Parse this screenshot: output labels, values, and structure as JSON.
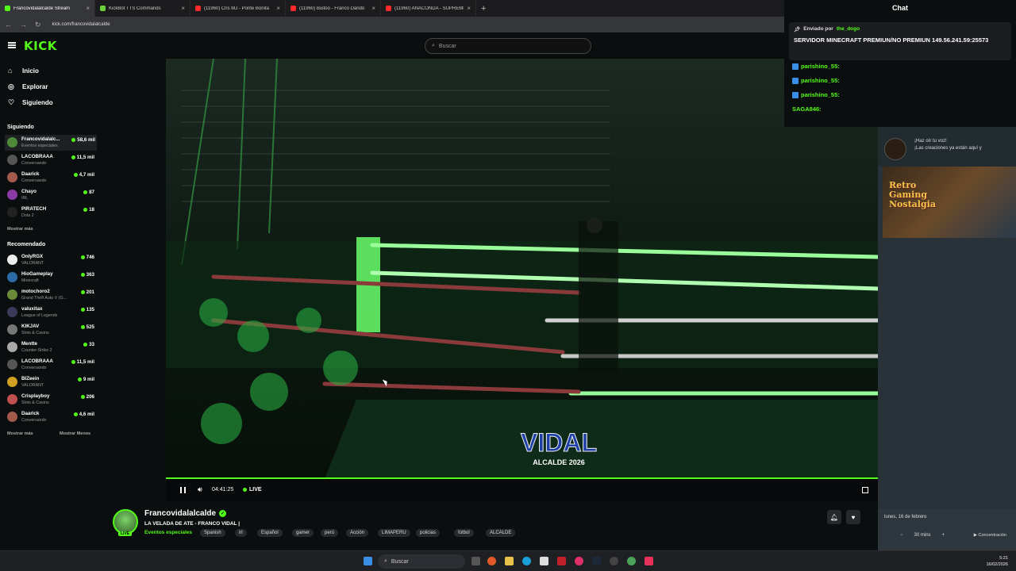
{
  "browser": {
    "tabs": [
      {
        "title": "Francovidalalcalde Stream",
        "active": true,
        "color": "#53fc18"
      },
      {
        "title": "KickBot TTS Commands",
        "active": false,
        "color": "#6bd13a"
      },
      {
        "title": "(11960) Cris MJ - Ponte Bonita",
        "active": false,
        "color": "#ff2a2a"
      },
      {
        "title": "(11960) Buitoo - Franco Dando",
        "active": false,
        "color": "#ff2a2a"
      },
      {
        "title": "(11960) ANACONDA - SUPREME",
        "active": false,
        "color": "#ff2a2a"
      }
    ],
    "url": "kick.com/francovidalalcalde"
  },
  "header": {
    "logo": "KICK",
    "search_placeholder": "Buscar"
  },
  "sidebar": {
    "nav": [
      {
        "label": "Inicio",
        "icon": "home-icon"
      },
      {
        "label": "Explorar",
        "icon": "compass-icon"
      },
      {
        "label": "Siguiendo",
        "icon": "heart-icon"
      }
    ],
    "following_title": "Siguiendo",
    "following": [
      {
        "name": "Francovidalalc...",
        "category": "Eventos especiales",
        "viewers": "58,6 mil",
        "color": "#4e8a3a"
      },
      {
        "name": "LACOBRAAA",
        "category": "Conversando",
        "viewers": "11,5 mil",
        "color": "#555"
      },
      {
        "name": "Daarick",
        "category": "Conversando",
        "viewers": "4,7 mil",
        "color": "#a35a4a"
      },
      {
        "name": "Chayo",
        "category": "IRL",
        "viewers": "87",
        "color": "#8a3aa5"
      },
      {
        "name": "PIRATECH",
        "category": "Dota 2",
        "viewers": "18",
        "color": "#222"
      }
    ],
    "show_more": "Mostrar más",
    "recommended_title": "Recomendado",
    "recommended": [
      {
        "name": "OnlyRGX",
        "category": "VALORANT",
        "viewers": "746",
        "color": "#eee"
      },
      {
        "name": "HioGameplay",
        "category": "Minecraft",
        "viewers": "363",
        "color": "#2a6aa5"
      },
      {
        "name": "motochoro2",
        "category": "Grand Theft Auto V (G...",
        "viewers": "201",
        "color": "#6a8a3a"
      },
      {
        "name": "valuxitax",
        "category": "League of Legends",
        "viewers": "135",
        "color": "#3a3a5a"
      },
      {
        "name": "KIKJAV",
        "category": "Slots & Casino",
        "viewers": "525",
        "color": "#777"
      },
      {
        "name": "Mentte",
        "category": "Counter-Strike 2",
        "viewers": "33",
        "color": "#aaa"
      },
      {
        "name": "LACOBRAAA",
        "category": "Conversando",
        "viewers": "11,5 mil",
        "color": "#555"
      },
      {
        "name": "BIZeein",
        "category": "VALORANT",
        "viewers": "9 mil",
        "color": "#d0a020"
      },
      {
        "name": "Crisplayboy",
        "category": "Slots & Casino",
        "viewers": "206",
        "color": "#c05050"
      },
      {
        "name": "Daarick",
        "category": "Conversando",
        "viewers": "4,6 mil",
        "color": "#a35a4a"
      }
    ],
    "rec_more": "Mostrar más",
    "rec_less": "Mostrar Menos"
  },
  "player": {
    "time": "04:41:25",
    "live": "LIVE",
    "overlay_text": "VIDAL",
    "overlay_sub": "ALCALDE 2026"
  },
  "stream": {
    "name": "Francovidalalcalde",
    "title": "LA VELADA DE ATE - FRANCO VIDAL |",
    "category": "Eventos especiales",
    "live_badge": "LIVE",
    "tags": [
      "Spanish",
      "irl",
      "Español",
      "gamer",
      "perú",
      "Acción",
      "LIMAPERU",
      "policias",
      "fútbol",
      "ALCALDE"
    ]
  },
  "chat": {
    "title": "Chat",
    "pinned_by_label": "Enviado por",
    "pinned_user": "the_dogo",
    "pinned_message": "SERVIDOR MINECRAFT PREMIUN/NO PREMIUN 149.56.241.59:25573",
    "messages": [
      {
        "user": "parishino_55:",
        "color": "#53fc18"
      },
      {
        "user": "parishino_55:",
        "color": "#53fc18"
      },
      {
        "user": "parishino_55:",
        "color": "#53fc18"
      },
      {
        "user": "SAGA846:",
        "color": "#53fc18"
      }
    ]
  },
  "widget": {
    "voice_line1": "¡Haz oír tu voz!",
    "voice_line2": "¡Las creaciones ya están aquí y",
    "promo_line1": "Retro",
    "promo_line2": "Gaming",
    "promo_line3": "Nostalgia",
    "date": "lunes, 16 de febrero",
    "minutes": "30 mins",
    "focus": "Concentración"
  },
  "taskbar": {
    "search": "Buscar",
    "time": "5:21",
    "date": "16/02/2026"
  }
}
